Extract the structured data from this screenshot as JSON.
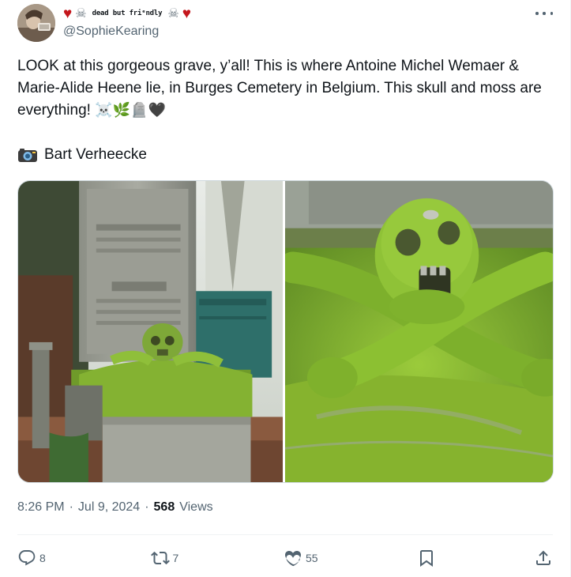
{
  "author": {
    "display_name": "dead but friᵉndly",
    "handle": "@SophieKearing"
  },
  "tweet": {
    "text": "LOOK at this gorgeous grave, y’all! This is where Antoine Michel Wemaer & Marie-Alide Heene lie, in Burges Cemetery in Belgium. This skull and moss are everything!",
    "text_emoji": "☠️🌿🪦🖤",
    "credit": "Bart Verheecke"
  },
  "meta": {
    "time": "8:26 PM",
    "date": "Jul 9, 2024",
    "separator": "·",
    "views_count": "568",
    "views_label": "Views"
  },
  "actions": {
    "replies": "8",
    "reposts": "7",
    "likes": "55"
  },
  "icons": [
    "heart-icon",
    "skull-icon",
    "more-icon",
    "camera-icon",
    "reply-icon",
    "repost-icon",
    "like-icon",
    "bookmark-icon",
    "share-icon"
  ],
  "colors": {
    "text": "#0f1419",
    "secondary": "#536471",
    "border": "#cfd9de",
    "heart": "#c4161c",
    "moss": "#7fb52c"
  }
}
